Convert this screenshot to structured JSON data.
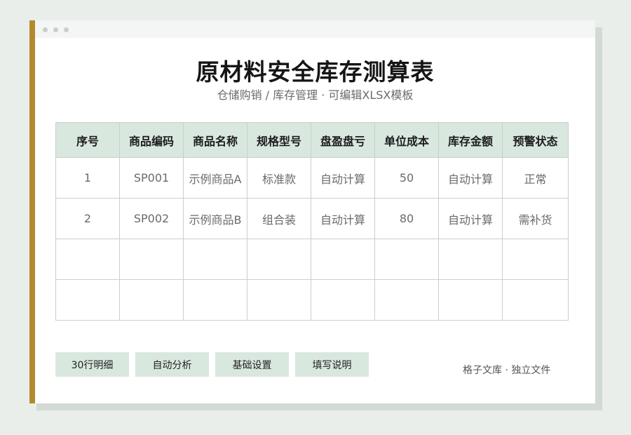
{
  "colors": {
    "accent": "#b38a2c",
    "header_bg": "#d9e8df",
    "page_bg": "#e9eeea"
  },
  "document": {
    "title": "原材料安全库存测算表",
    "subtitle": "仓储购销 / 库存管理 · 可编辑XLSX模板"
  },
  "table": {
    "headers": [
      "序号",
      "商品编码",
      "商品名称",
      "规格型号",
      "盘盈盘亏",
      "单位成本",
      "库存金额",
      "预警状态"
    ],
    "rows": [
      [
        "1",
        "SP001",
        "示例商品A",
        "标准款",
        "自动计算",
        "50",
        "自动计算",
        "正常"
      ],
      [
        "2",
        "SP002",
        "示例商品B",
        "组合装",
        "自动计算",
        "80",
        "自动计算",
        "需补货"
      ],
      [
        "",
        "",
        "",
        "",
        "",
        "",
        "",
        ""
      ],
      [
        "",
        "",
        "",
        "",
        "",
        "",
        "",
        ""
      ]
    ]
  },
  "buttons": [
    "30行明细",
    "自动分析",
    "基础设置",
    "填写说明"
  ],
  "footer": "格子文库 · 独立文件"
}
